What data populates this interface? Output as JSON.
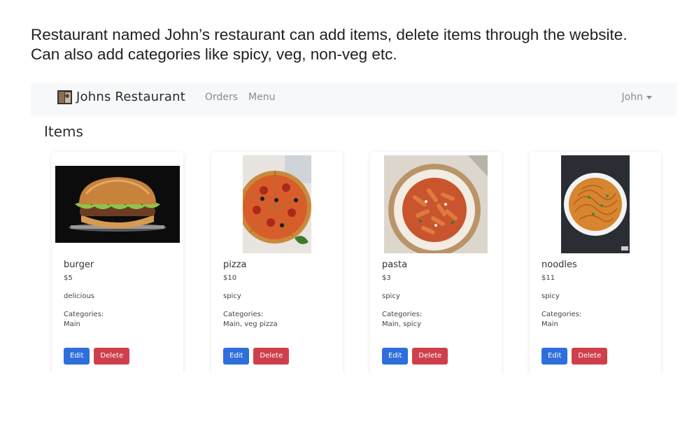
{
  "description": {
    "line1": "Restaurant named John’s restaurant can add items, delete items through the website.",
    "line2": "Can also add categories like spicy, veg, non-veg etc."
  },
  "navbar": {
    "brand": "Johns Restaurant",
    "links": [
      "Orders",
      "Menu"
    ],
    "user": "John"
  },
  "page": {
    "title": "Items"
  },
  "items": [
    {
      "name": "burger",
      "price": "$5",
      "description": "delicious",
      "categories_label": "Categories:",
      "categories": "Main",
      "edit_label": "Edit",
      "delete_label": "Delete",
      "image": "burger-photo"
    },
    {
      "name": "pizza",
      "price": "$10",
      "description": "spicy",
      "categories_label": "Categories:",
      "categories": "Main, veg pizza",
      "edit_label": "Edit",
      "delete_label": "Delete",
      "image": "pizza-photo"
    },
    {
      "name": "pasta",
      "price": "$3",
      "description": "spicy",
      "categories_label": "Categories:",
      "categories": "Main, spicy",
      "edit_label": "Edit",
      "delete_label": "Delete",
      "image": "pasta-photo"
    },
    {
      "name": "noodles",
      "price": "$11",
      "description": "spicy",
      "categories_label": "Categories:",
      "categories": "Main",
      "edit_label": "Edit",
      "delete_label": "Delete",
      "image": "noodles-photo"
    }
  ],
  "colors": {
    "edit_button": "#2f6fdb",
    "delete_button": "#cf3f4b",
    "navbar_bg": "#f7f8f9"
  }
}
